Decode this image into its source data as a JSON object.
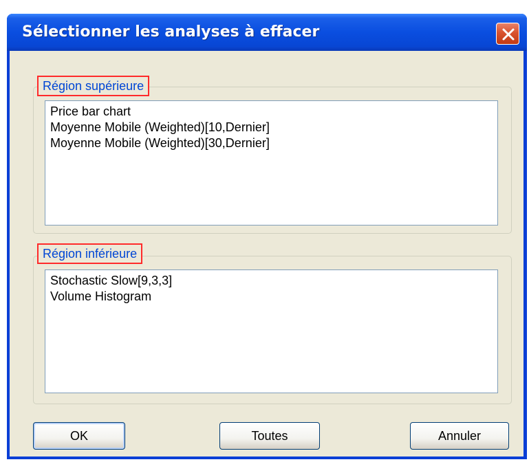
{
  "window": {
    "title": "Sélectionner les analyses à effacer"
  },
  "upper_region": {
    "label": "Région supérieure",
    "items": [
      "Price bar chart",
      "Moyenne Mobile (Weighted)[10,Dernier]",
      "Moyenne Mobile (Weighted)[30,Dernier]"
    ]
  },
  "lower_region": {
    "label": "Région inférieure",
    "items": [
      "Stochastic Slow[9,3,3]",
      "Volume Histogram"
    ]
  },
  "buttons": {
    "ok": "OK",
    "all": "Toutes",
    "cancel": "Annuler"
  },
  "icons": {
    "close": "close-icon"
  },
  "colors": {
    "titlebar": "#0a4ee0",
    "close_button": "#d9532f",
    "group_label": "#0046d5",
    "highlight_box": "#ff2a2a",
    "dialog_background": "#ece9d8"
  }
}
